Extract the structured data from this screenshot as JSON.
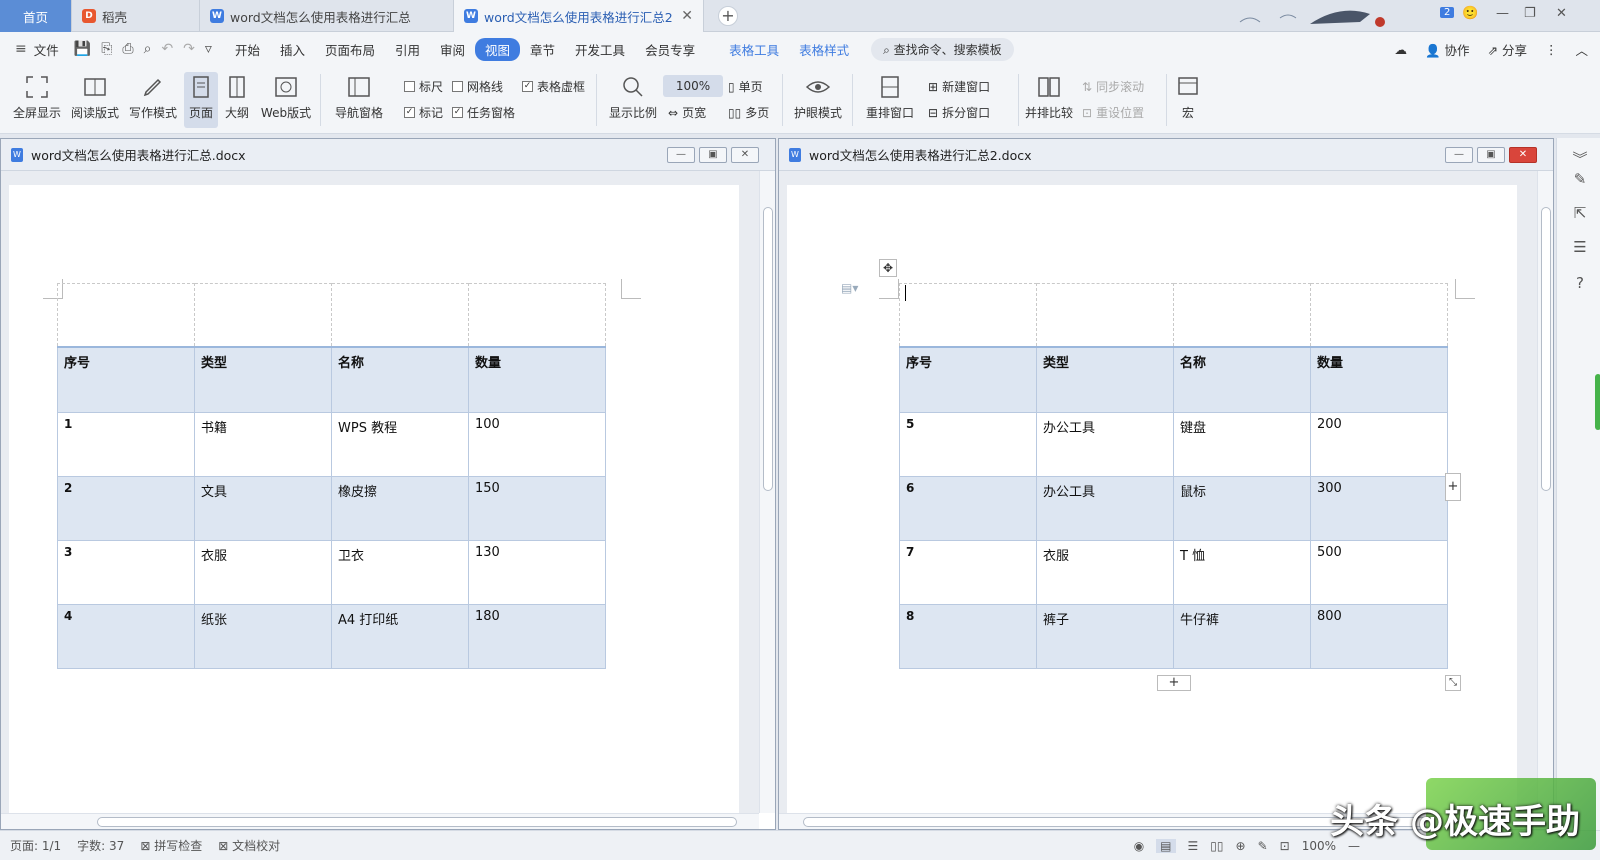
{
  "tabs": {
    "home": "首页",
    "t1": "稻壳",
    "t2": "word文档怎么使用表格进行汇总",
    "t3": "word文档怎么使用表格进行汇总2"
  },
  "notification_count": "2",
  "menu": {
    "file": "文件",
    "items": [
      "开始",
      "插入",
      "页面布局",
      "引用",
      "审阅",
      "视图",
      "章节",
      "开发工具",
      "会员专享"
    ],
    "active": "视图",
    "table_tools": "表格工具",
    "table_style": "表格样式",
    "search": "查找命令、搜索模板",
    "collab": "协作",
    "share": "分享"
  },
  "ribbon": {
    "fullscreen": "全屏显示",
    "reading": "阅读版式",
    "writing": "写作模式",
    "page": "页面",
    "outline": "大纲",
    "web": "Web版式",
    "nav_pane": "导航窗格",
    "ruler": "标尺",
    "gridlines": "网格线",
    "table_border": "表格虚框",
    "marks": "标记",
    "task_pane": "任务窗格",
    "zoom_ratio": "显示比例",
    "zoom_100": "100%",
    "single_page": "单页",
    "page_width": "页宽",
    "multi_page": "多页",
    "eye_mode": "护眼模式",
    "rearrange": "重排窗口",
    "new_window": "新建窗口",
    "split_window": "拆分窗口",
    "side_by_side": "并排比较",
    "sync_scroll": "同步滚动",
    "reset_pos": "重设位置",
    "macro": "宏"
  },
  "left_doc": {
    "title": "word文档怎么使用表格进行汇总.docx",
    "header": [
      "序号",
      "类型",
      "名称",
      "数量"
    ],
    "rows": [
      [
        "1",
        "书籍",
        "WPS 教程",
        "100"
      ],
      [
        "2",
        "文具",
        "橡皮擦",
        "150"
      ],
      [
        "3",
        "衣服",
        "卫衣",
        "130"
      ],
      [
        "4",
        "纸张",
        "A4 打印纸",
        "180"
      ]
    ]
  },
  "right_doc": {
    "title": "word文档怎么使用表格进行汇总2.docx",
    "header": [
      "序号",
      "类型",
      "名称",
      "数量"
    ],
    "rows": [
      [
        "5",
        "办公工具",
        "键盘",
        "200"
      ],
      [
        "6",
        "办公工具",
        "鼠标",
        "300"
      ],
      [
        "7",
        "衣服",
        "T 恤",
        "500"
      ],
      [
        "8",
        "裤子",
        "牛仔裤",
        "800"
      ]
    ]
  },
  "status": {
    "page": "页面: 1/1",
    "words": "字数: 37",
    "spell": "拼写检查",
    "proof": "文档校对",
    "zoom": "100%"
  },
  "watermark": "头条 @极速手助",
  "colors": {
    "accent": "#3f7ce0",
    "table_band": "#dde6f2",
    "close_red": "#d9453b"
  }
}
